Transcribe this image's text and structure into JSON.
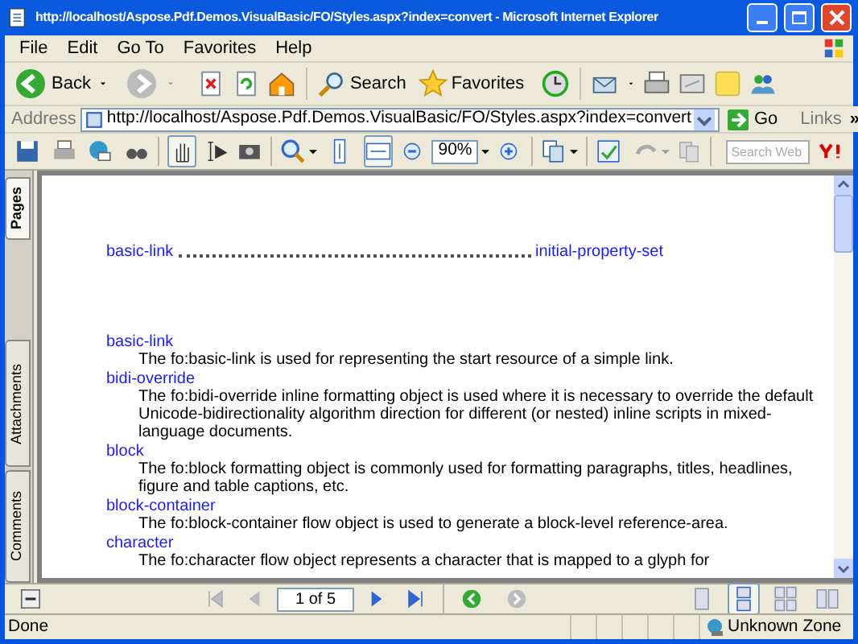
{
  "window": {
    "title": "http://localhost/Aspose.Pdf.Demos.VisualBasic/FO/Styles.aspx?index=convert - Microsoft Internet Explorer"
  },
  "menu": [
    "File",
    "Edit",
    "Go To",
    "Favorites",
    "Help"
  ],
  "toolbar": {
    "back": "Back",
    "search": "Search",
    "favorites": "Favorites"
  },
  "address_bar": {
    "label": "Address",
    "url": "http://localhost/Aspose.Pdf.Demos.VisualBasic/FO/Styles.aspx?index=convert",
    "go": "Go",
    "links": "Links",
    "more": "»"
  },
  "pdf_toolbar": {
    "zoom": "90%",
    "search_placeholder": "Search Web"
  },
  "side_tabs": [
    {
      "label": "Pages",
      "selected": true
    },
    {
      "label": "Attachments",
      "selected": false
    },
    {
      "label": "Comments",
      "selected": false
    }
  ],
  "document": {
    "toc": {
      "start": "basic-link",
      "end": "initial-property-set"
    },
    "entries": [
      {
        "term": "basic-link",
        "description": "The fo:basic-link is used for representing the start resource of a simple link."
      },
      {
        "term": "bidi-override",
        "description": "The fo:bidi-override inline formatting object is used where it is necessary to override the default Unicode-bidirectionality algorithm direction for different (or nested) inline scripts in mixed-language documents."
      },
      {
        "term": "block",
        "description": "The fo:block formatting object is commonly used for formatting paragraphs, titles, headlines, figure and table captions, etc."
      },
      {
        "term": "block-container",
        "description": "The fo:block-container flow object is used to generate a block-level reference-area."
      },
      {
        "term": "character",
        "description": "The fo:character flow object represents a character that is mapped to a glyph for"
      }
    ]
  },
  "navigation": {
    "page": "1 of 5"
  },
  "status_bar": {
    "text": "Done",
    "zone": "Unknown Zone"
  }
}
